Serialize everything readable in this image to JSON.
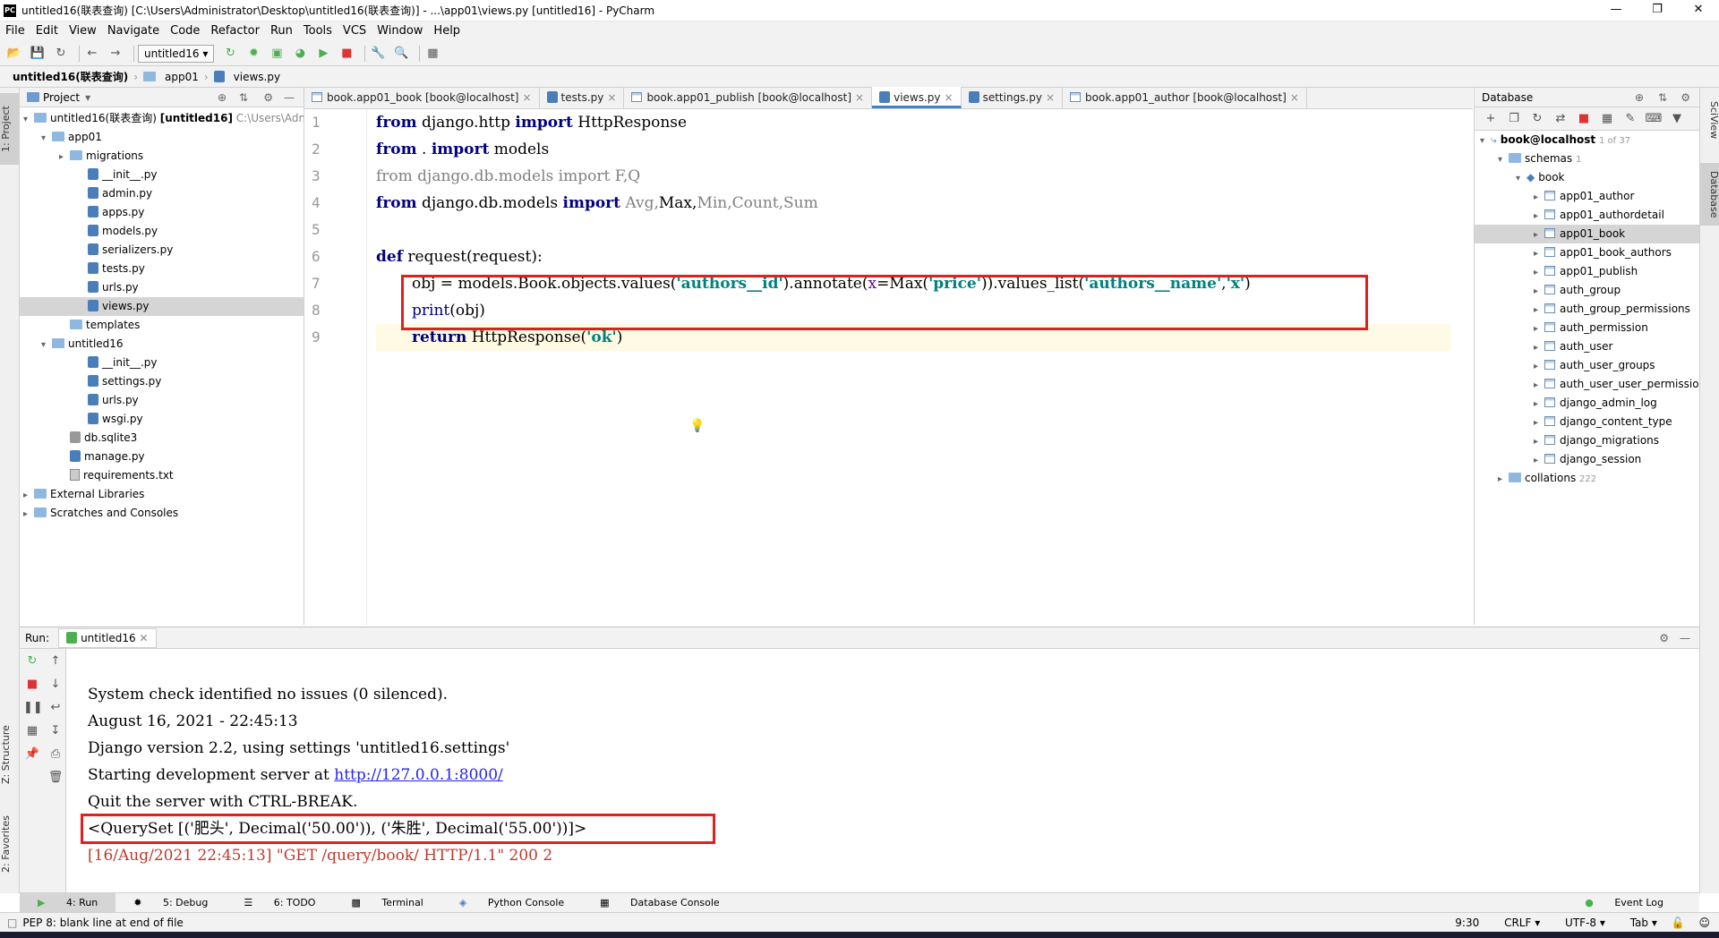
{
  "window": {
    "title": "untitled16(联表查询) [C:\\Users\\Administrator\\Desktop\\untitled16(联表查询)] - ...\\app01\\views.py [untitled16] - PyCharm",
    "logo": "PC"
  },
  "menu": [
    "File",
    "Edit",
    "View",
    "Navigate",
    "Code",
    "Refactor",
    "Run",
    "Tools",
    "VCS",
    "Window",
    "Help"
  ],
  "toolbar": {
    "run_config": "untitled16"
  },
  "breadcrumb": [
    "untitled16(联表查询)",
    "app01",
    "views.py"
  ],
  "left_strip": {
    "project": "1: Project",
    "structure": "Z: Structure",
    "favorites": "2: Favorites"
  },
  "right_strip": {
    "sciview": "SciView",
    "database": "Database"
  },
  "project": {
    "header": "Project",
    "root": {
      "name": "untitled16(联表查询)",
      "module": "[untitled16]",
      "path": "C:\\Users\\Admi"
    },
    "rows": [
      {
        "label": "app01",
        "type": "folder",
        "level": 1,
        "arrow": "▾"
      },
      {
        "label": "migrations",
        "type": "folder",
        "level": 2,
        "arrow": "▸"
      },
      {
        "label": "__init__.py",
        "type": "py",
        "level": 3
      },
      {
        "label": "admin.py",
        "type": "py",
        "level": 3
      },
      {
        "label": "apps.py",
        "type": "py",
        "level": 3
      },
      {
        "label": "models.py",
        "type": "py",
        "level": 3
      },
      {
        "label": "serializers.py",
        "type": "py",
        "level": 3
      },
      {
        "label": "tests.py",
        "type": "py",
        "level": 3
      },
      {
        "label": "urls.py",
        "type": "py",
        "level": 3
      },
      {
        "label": "views.py",
        "type": "py",
        "level": 3,
        "selected": true
      },
      {
        "label": "templates",
        "type": "folder",
        "level": 2
      },
      {
        "label": "untitled16",
        "type": "folder",
        "level": 1,
        "arrow": "▾"
      },
      {
        "label": "__init__.py",
        "type": "py",
        "level": 3
      },
      {
        "label": "settings.py",
        "type": "py",
        "level": 3
      },
      {
        "label": "urls.py",
        "type": "py",
        "level": 3
      },
      {
        "label": "wsgi.py",
        "type": "py",
        "level": 3
      },
      {
        "label": "db.sqlite3",
        "type": "db",
        "level": 2
      },
      {
        "label": "manage.py",
        "type": "py",
        "level": 2
      },
      {
        "label": "requirements.txt",
        "type": "txt",
        "level": 2
      },
      {
        "label": "External Libraries",
        "type": "lib",
        "level": 0,
        "arrow": "▸"
      },
      {
        "label": "Scratches and Consoles",
        "type": "scratch",
        "level": 0,
        "arrow": "▸"
      }
    ]
  },
  "editor": {
    "tabs": [
      {
        "label": "book.app01_book [book@localhost]",
        "kind": "table"
      },
      {
        "label": "tests.py",
        "kind": "py"
      },
      {
        "label": "book.app01_publish [book@localhost]",
        "kind": "table"
      },
      {
        "label": "views.py",
        "kind": "py",
        "active": true
      },
      {
        "label": "settings.py",
        "kind": "py"
      },
      {
        "label": "book.app01_author [book@localhost]",
        "kind": "table"
      }
    ],
    "line_numbers": [
      "1",
      "2",
      "3",
      "4",
      "5",
      "6",
      "7",
      "8",
      "9"
    ],
    "code": {
      "l1_kw1": "from",
      "l1_mod": " django.http ",
      "l1_kw2": "import",
      "l1_name": " HttpResponse",
      "l2_kw1": "from",
      "l2_mod": " . ",
      "l2_kw2": "import",
      "l2_name": " models",
      "l3": "from django.db.models import F,Q",
      "l4_kw1": "from",
      "l4_mod": " django.db.models ",
      "l4_kw2": "import",
      "l4_avg": " Avg,",
      "l4_max": "Max,",
      "l4_rest": "Min,Count,Sum",
      "l6_kw": "def",
      "l6_name": " request(request):",
      "l7_a": "obj = models.Book.objects.values(",
      "l7_s1": "'authors__id'",
      "l7_b": ").annotate(",
      "l7_x": "x",
      "l7_c": "=Max(",
      "l7_s2": "'price'",
      "l7_d": ")).values_list(",
      "l7_s3": "'authors__name'",
      "l7_e": ",",
      "l7_s4": "'x'",
      "l7_f": ")",
      "l8_fn": "print",
      "l8_rest": "(obj)",
      "l9_kw": "return",
      "l9_a": " HttpResponse(",
      "l9_s": "'ok'",
      "l9_b": ")"
    }
  },
  "database": {
    "header": "Database",
    "host": "book@localhost",
    "host_count": "1 of 37",
    "schemas": "schemas",
    "schemas_count": "1",
    "schema": "book",
    "tables": [
      "app01_author",
      "app01_authordetail",
      "app01_book",
      "app01_book_authors",
      "app01_publish",
      "auth_group",
      "auth_group_permissions",
      "auth_permission",
      "auth_user",
      "auth_user_groups",
      "auth_user_user_permissio",
      "django_admin_log",
      "django_content_type",
      "django_migrations",
      "django_session"
    ],
    "selected_table": "app01_book",
    "collations": "collations",
    "collations_count": "222"
  },
  "run": {
    "label": "Run:",
    "config": "untitled16",
    "lines": [
      "System check identified no issues (0 silenced).",
      "August 16, 2021 - 22:45:13",
      "Django version 2.2, using settings 'untitled16.settings'"
    ],
    "server_prefix": "Starting development server at ",
    "server_url": "http://127.0.0.1:8000/",
    "quit": "Quit the server with CTRL-BREAK.",
    "queryset": "<QuerySet [('肥头', Decimal('50.00')), ('朱胜', Decimal('55.00'))]>",
    "request_log": "[16/Aug/2021 22:45:13] \"GET /query/book/ HTTP/1.1\" 200 2"
  },
  "bottom_tabs": [
    "4: Run",
    "5: Debug",
    "6: TODO",
    "Terminal",
    "Python Console",
    "Database Console"
  ],
  "event_log": "Event Log",
  "status": {
    "message": "PEP 8: blank line at end of file",
    "position": "9:30",
    "line_sep": "CRLF",
    "encoding": "UTF-8",
    "indent": "Tab"
  }
}
